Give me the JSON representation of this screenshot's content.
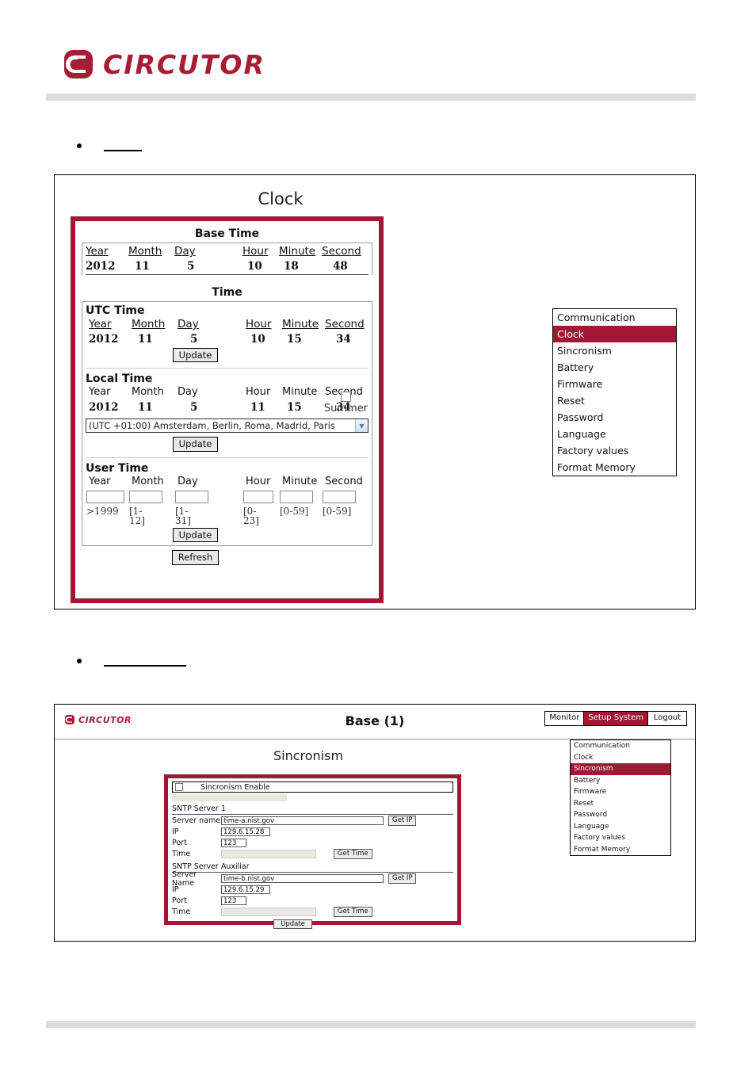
{
  "brand": {
    "name": "CIRCUTOR",
    "accent": "#a81d36"
  },
  "bullets": [
    {
      "name": "bullet-clock",
      "label": ""
    },
    {
      "name": "bullet-sincronism",
      "label": ""
    }
  ],
  "figure_clock": {
    "title": "Clock",
    "base_time": {
      "section_label": "Base Time",
      "headers": [
        "Year",
        "Month",
        "Day",
        "Hour",
        "Minute",
        "Second"
      ],
      "values": [
        "2012",
        "11",
        "5",
        "10",
        "18",
        "48"
      ]
    },
    "time_label": "Time",
    "utc_time": {
      "group_label": "UTC Time",
      "headers": [
        "Year",
        "Month",
        "Day",
        "Hour",
        "Minute",
        "Second"
      ],
      "values": [
        "2012",
        "11",
        "5",
        "10",
        "15",
        "34"
      ],
      "update_label": "Update"
    },
    "local_time": {
      "group_label": "Local Time",
      "headers": [
        "Year",
        "Month",
        "Day",
        "Hour",
        "Minute",
        "Second"
      ],
      "values": [
        "2012",
        "11",
        "5",
        "11",
        "15",
        "34"
      ],
      "summer_label": "Summer",
      "summer_checked": false,
      "timezone_selected": "(UTC +01:00) Amsterdam, Berlin, Roma, Madrid, Paris",
      "update_label": "Update"
    },
    "user_time": {
      "group_label": "User Time",
      "headers": [
        "Year",
        "Month",
        "Day",
        "Hour",
        "Minute",
        "Second"
      ],
      "values": [
        "",
        "",
        "",
        "",
        "",
        ""
      ],
      "hints": [
        ">1999",
        "[1-12]",
        "[1-31]",
        "[0-23]",
        "[0-59]",
        "[0-59]"
      ],
      "update_label": "Update"
    },
    "refresh_label": "Refresh",
    "menu": {
      "items": [
        {
          "label": "Communication",
          "active": false
        },
        {
          "label": "Clock",
          "active": true
        },
        {
          "label": "Sincronism",
          "active": false
        },
        {
          "label": "Battery",
          "active": false
        },
        {
          "label": "Firmware",
          "active": false
        },
        {
          "label": "Reset",
          "active": false
        },
        {
          "label": "Password",
          "active": false
        },
        {
          "label": "Language",
          "active": false
        },
        {
          "label": "Factory values",
          "active": false
        },
        {
          "label": "Format Memory",
          "active": false
        }
      ]
    }
  },
  "figure_sinc": {
    "app_title": "Base (1)",
    "nav_buttons": [
      {
        "label": "Monitor",
        "active": false
      },
      {
        "label": "Setup System",
        "active": true
      },
      {
        "label": "Logout",
        "active": false
      }
    ],
    "page_title": "Sincronism",
    "enable": {
      "label": "Sincronism Enable",
      "checked": false
    },
    "server1": {
      "group_label": "SNTP Server 1",
      "name_label": "Server name",
      "name_value": "time-a.nist.gov",
      "get_ip_label": "Get IP",
      "ip_label": "IP",
      "ip_value": "129.6.15.28",
      "port_label": "Port",
      "port_value": "123",
      "time_label": "Time",
      "time_value": "",
      "get_time_label": "Get Time"
    },
    "server_aux": {
      "group_label": "SNTP Server Auxiliar",
      "name_label": "Server Name",
      "name_value": "time-b.nist.gov",
      "get_ip_label": "Get IP",
      "ip_label": "IP",
      "ip_value": "129.6.15.29",
      "port_label": "Port",
      "port_value": "123",
      "time_label": "Time",
      "time_value": "",
      "get_time_label": "Get Time"
    },
    "update_label": "Update",
    "menu": {
      "items": [
        {
          "label": "Communication",
          "active": false
        },
        {
          "label": "Clock",
          "active": false
        },
        {
          "label": "Sincronism",
          "active": true
        },
        {
          "label": "Battery",
          "active": false
        },
        {
          "label": "Firmware",
          "active": false
        },
        {
          "label": "Reset",
          "active": false
        },
        {
          "label": "Password",
          "active": false
        },
        {
          "label": "Language",
          "active": false
        },
        {
          "label": "Factory values",
          "active": false
        },
        {
          "label": "Format Memory",
          "active": false
        }
      ]
    }
  }
}
